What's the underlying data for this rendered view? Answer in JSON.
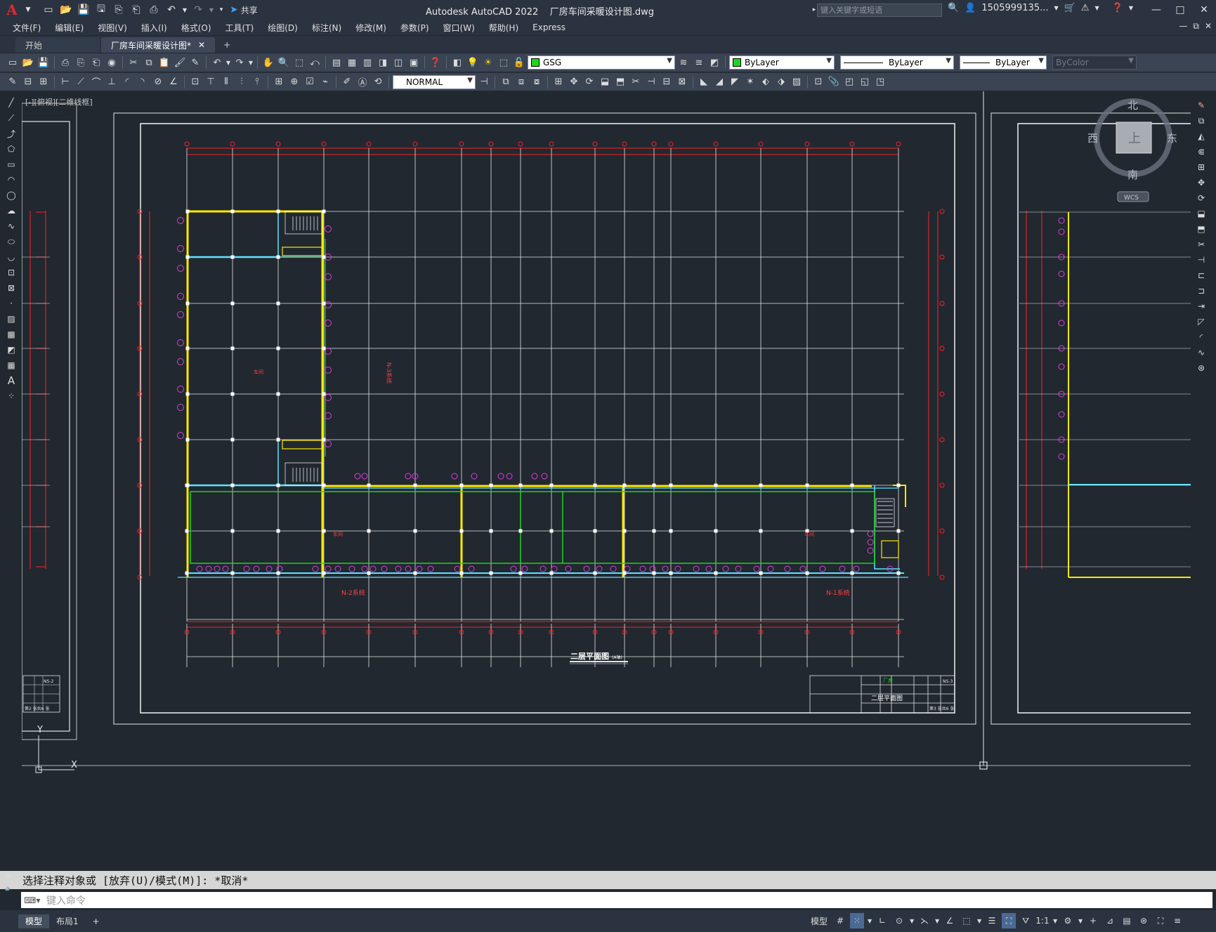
{
  "app": {
    "logo": "A",
    "product": "Autodesk AutoCAD 2022",
    "filename": "厂房车间采暖设计图.dwg",
    "share": "共享",
    "search_placeholder": "键入关键字或短语",
    "user": "1505999135...",
    "window_controls": [
      "—",
      "□",
      "✕"
    ],
    "mdi_controls": [
      "—",
      "⧉",
      "✕"
    ]
  },
  "menu": [
    "文件(F)",
    "编辑(E)",
    "视图(V)",
    "插入(I)",
    "格式(O)",
    "工具(T)",
    "绘图(D)",
    "标注(N)",
    "修改(M)",
    "参数(P)",
    "窗口(W)",
    "帮助(H)",
    "Express"
  ],
  "tabs": [
    {
      "label": "开始",
      "active": false
    },
    {
      "label": "厂房车间采暖设计图*",
      "active": true,
      "close": "✕"
    },
    {
      "label": "+",
      "active": false
    }
  ],
  "toolbar": {
    "layer": "GSG",
    "color": "ByLayer",
    "linetype": "ByLayer",
    "lineweight": "ByLayer",
    "plotstyle": "ByColor",
    "dimstyle": "NORMAL",
    "layer_color": "#1fd61f"
  },
  "viewport_label": "[-][俯视][二维线框]",
  "viewcube": {
    "north": "北",
    "south": "南",
    "east": "东",
    "west": "西",
    "top": "上",
    "wcs": "WCS"
  },
  "ucs": {
    "x": "X",
    "y": "Y"
  },
  "drawing": {
    "title": "二层平面图",
    "title_note": "(A轴)",
    "titleblock_right": {
      "company": "厂房",
      "drawing_name": "二层平面图",
      "drawing_no": "NS-3",
      "sheet": "第3 张共6 张"
    },
    "titleblock_left": {
      "drawing_no": "NS-2",
      "sheet": "第2 张共6 张"
    },
    "labels": [
      "N-2系统",
      "N-1系统",
      "N-3系统",
      "车间"
    ]
  },
  "command": {
    "history": "选择注释对象或 [放弃(U)/模式(M)]: *取消*",
    "placeholder": "键入命令"
  },
  "status": {
    "layouts": [
      "模型",
      "布局1",
      "+"
    ],
    "model_label": "模型",
    "scale": "1:1"
  }
}
